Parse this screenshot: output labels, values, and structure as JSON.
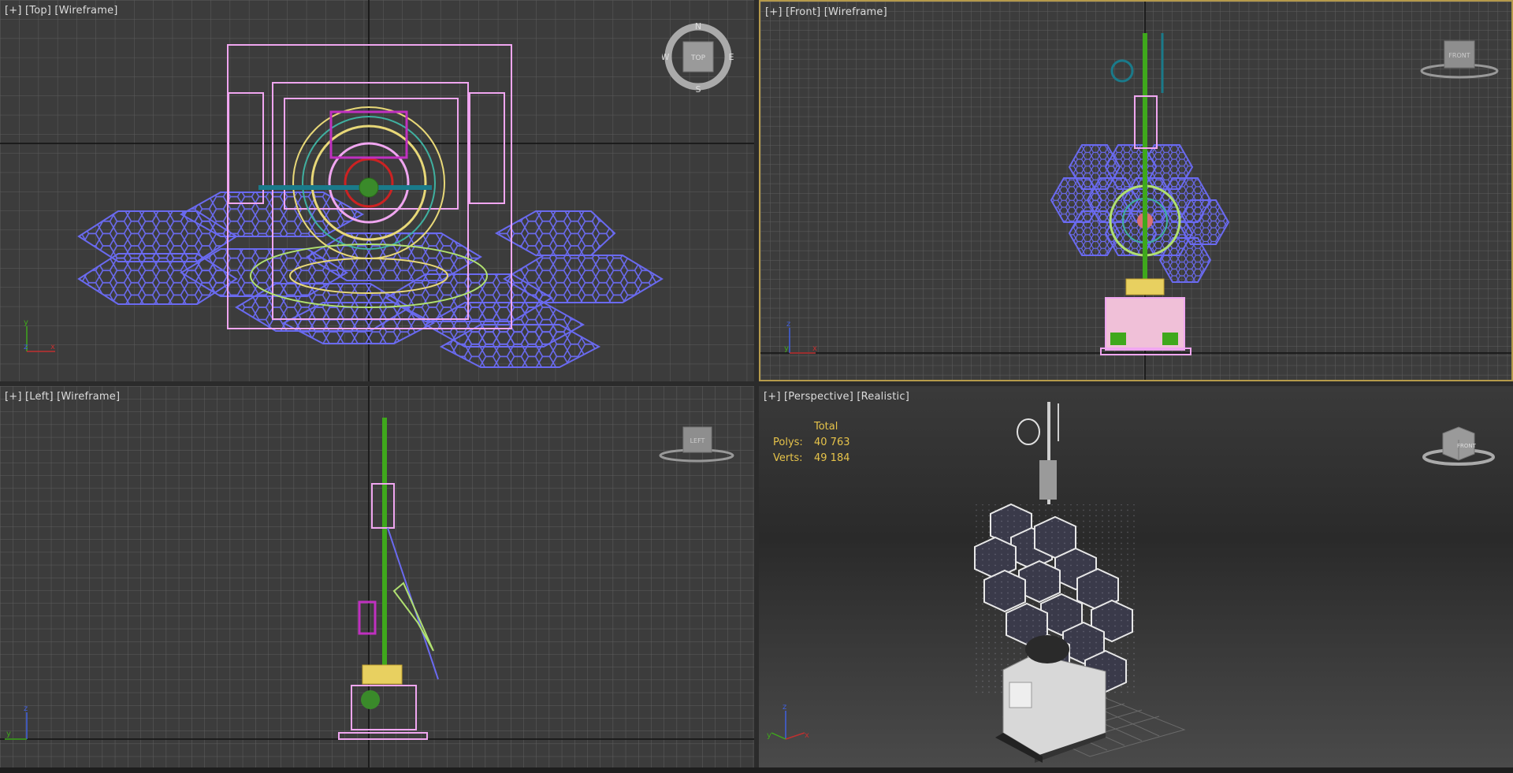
{
  "viewports": {
    "top": {
      "plus": "[+]",
      "view": "[Top]",
      "mode": "[Wireframe]",
      "cube_label": "TOP",
      "compass": {
        "n": "N",
        "s": "S",
        "e": "E",
        "w": "W"
      }
    },
    "front": {
      "plus": "[+]",
      "view": "[Front]",
      "mode": "[Wireframe]",
      "cube_label": "FRONT"
    },
    "left": {
      "plus": "[+]",
      "view": "[Left]",
      "mode": "[Wireframe]",
      "cube_label": "LEFT"
    },
    "perspective": {
      "plus": "[+]",
      "view": "[Perspective]",
      "mode": "[Realistic]",
      "cube_label": "FRONT",
      "stats": {
        "header": "Total",
        "polys_label": "Polys:",
        "polys_value": "40 763",
        "verts_label": "Verts:",
        "verts_value": "49 184"
      }
    }
  },
  "colors": {
    "grid_bg": "#3c3c3c",
    "grid_line": "#5a5a5a",
    "grid_major": "#111111",
    "active_border": "#b59a4b",
    "panels": "#6565e6",
    "frame": "#f0a6f0",
    "mast": "#3fa81c",
    "stats": "#e6c34a"
  },
  "axes": {
    "x": "x",
    "y": "y",
    "z": "z"
  }
}
